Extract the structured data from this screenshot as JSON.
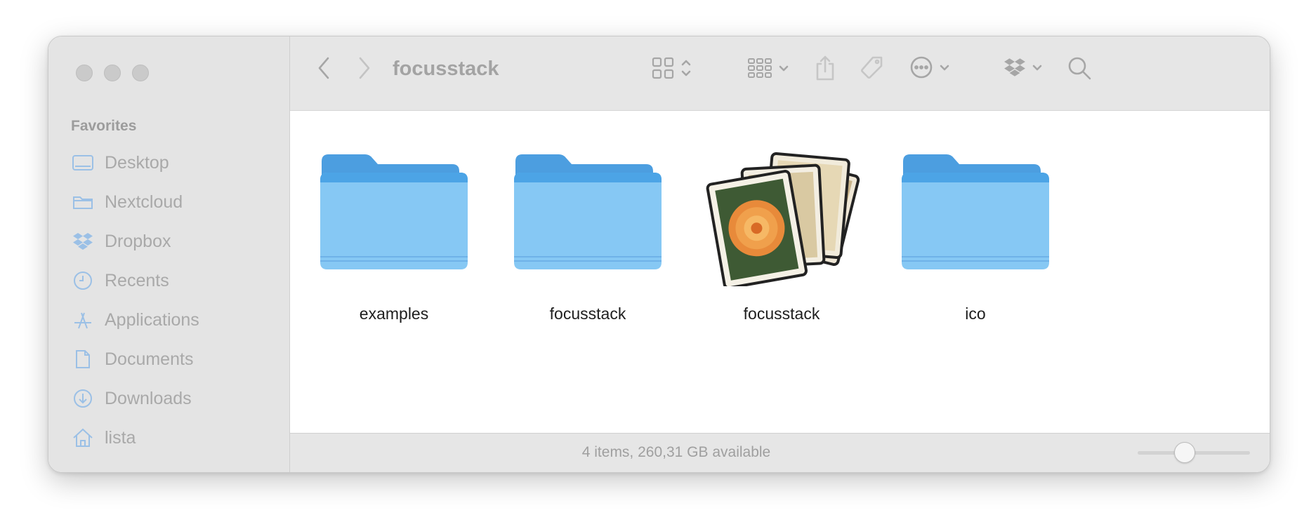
{
  "window": {
    "traffic_lights": [
      "close",
      "minimize",
      "zoom"
    ]
  },
  "sidebar": {
    "section_title": "Favorites",
    "items": [
      {
        "label": "Desktop",
        "icon": "desktop-icon"
      },
      {
        "label": "Nextcloud",
        "icon": "folder-icon"
      },
      {
        "label": "Dropbox",
        "icon": "dropbox-icon"
      },
      {
        "label": "Recents",
        "icon": "clock-icon"
      },
      {
        "label": "Applications",
        "icon": "applications-icon"
      },
      {
        "label": "Documents",
        "icon": "document-icon"
      },
      {
        "label": "Downloads",
        "icon": "download-icon"
      },
      {
        "label": "lista",
        "icon": "home-icon"
      }
    ]
  },
  "toolbar": {
    "title": "focusstack",
    "buttons": [
      "back-icon",
      "forward-icon",
      "icon-view-icon",
      "group-icon",
      "share-icon",
      "tag-icon",
      "more-icon",
      "dropbox-icon",
      "search-icon"
    ]
  },
  "content": {
    "items": [
      {
        "name": "examples",
        "kind": "folder"
      },
      {
        "name": "focusstack",
        "kind": "folder"
      },
      {
        "name": "focusstack",
        "kind": "application"
      },
      {
        "name": "ico",
        "kind": "folder"
      }
    ]
  },
  "statusbar": {
    "text": "4 items, 260,31 GB available",
    "zoom_level": 0.4
  },
  "colors": {
    "folder_front": "#86c8f4",
    "folder_back": "#4c9ee0",
    "sidebar_icon": "#9bc0e6"
  }
}
